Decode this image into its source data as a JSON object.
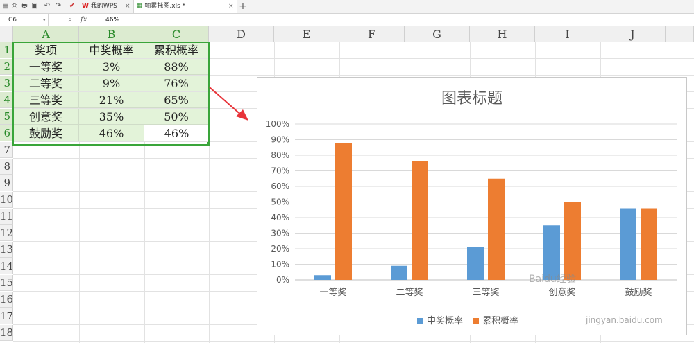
{
  "tabbar": {
    "tabs": [
      {
        "label": "我的WPS"
      },
      {
        "label": "帕累托图.xls *"
      }
    ]
  },
  "formula_bar": {
    "cell_ref": "C6",
    "fx_label": "fx",
    "value": "46%"
  },
  "sheet": {
    "columns": [
      "A",
      "B",
      "C",
      "D",
      "E",
      "F",
      "G",
      "H",
      "I",
      "J"
    ],
    "rows": [
      "1",
      "2",
      "3",
      "4",
      "5",
      "6",
      "7",
      "8",
      "9",
      "10",
      "11",
      "12",
      "13",
      "14",
      "15",
      "16",
      "17",
      "18"
    ],
    "table": [
      [
        "奖项",
        "中奖概率",
        "累积概率"
      ],
      [
        "一等奖",
        "3%",
        "88%"
      ],
      [
        "二等奖",
        "9%",
        "76%"
      ],
      [
        "三等奖",
        "21%",
        "65%"
      ],
      [
        "创意奖",
        "35%",
        "50%"
      ],
      [
        "鼓励奖",
        "46%",
        "46%"
      ]
    ]
  },
  "colors": {
    "series1": "#5b9bd5",
    "series2": "#ed7d31",
    "selection": "#3aa53a",
    "arrow": "#e8343a"
  },
  "chart_data": {
    "type": "bar",
    "title": "图表标题",
    "categories": [
      "一等奖",
      "二等奖",
      "三等奖",
      "创意奖",
      "鼓励奖"
    ],
    "series": [
      {
        "name": "中奖概率",
        "values": [
          3,
          9,
          21,
          35,
          46
        ]
      },
      {
        "name": "累积概率",
        "values": [
          88,
          76,
          65,
          50,
          46
        ]
      }
    ],
    "y_ticks": [
      "0%",
      "10%",
      "20%",
      "30%",
      "40%",
      "50%",
      "60%",
      "70%",
      "80%",
      "90%",
      "100%"
    ],
    "ylim": [
      0,
      100
    ],
    "grid": true,
    "legend": "bottom"
  },
  "watermark": {
    "brand": "Baidu经验",
    "url": "jingyan.baidu.com"
  }
}
